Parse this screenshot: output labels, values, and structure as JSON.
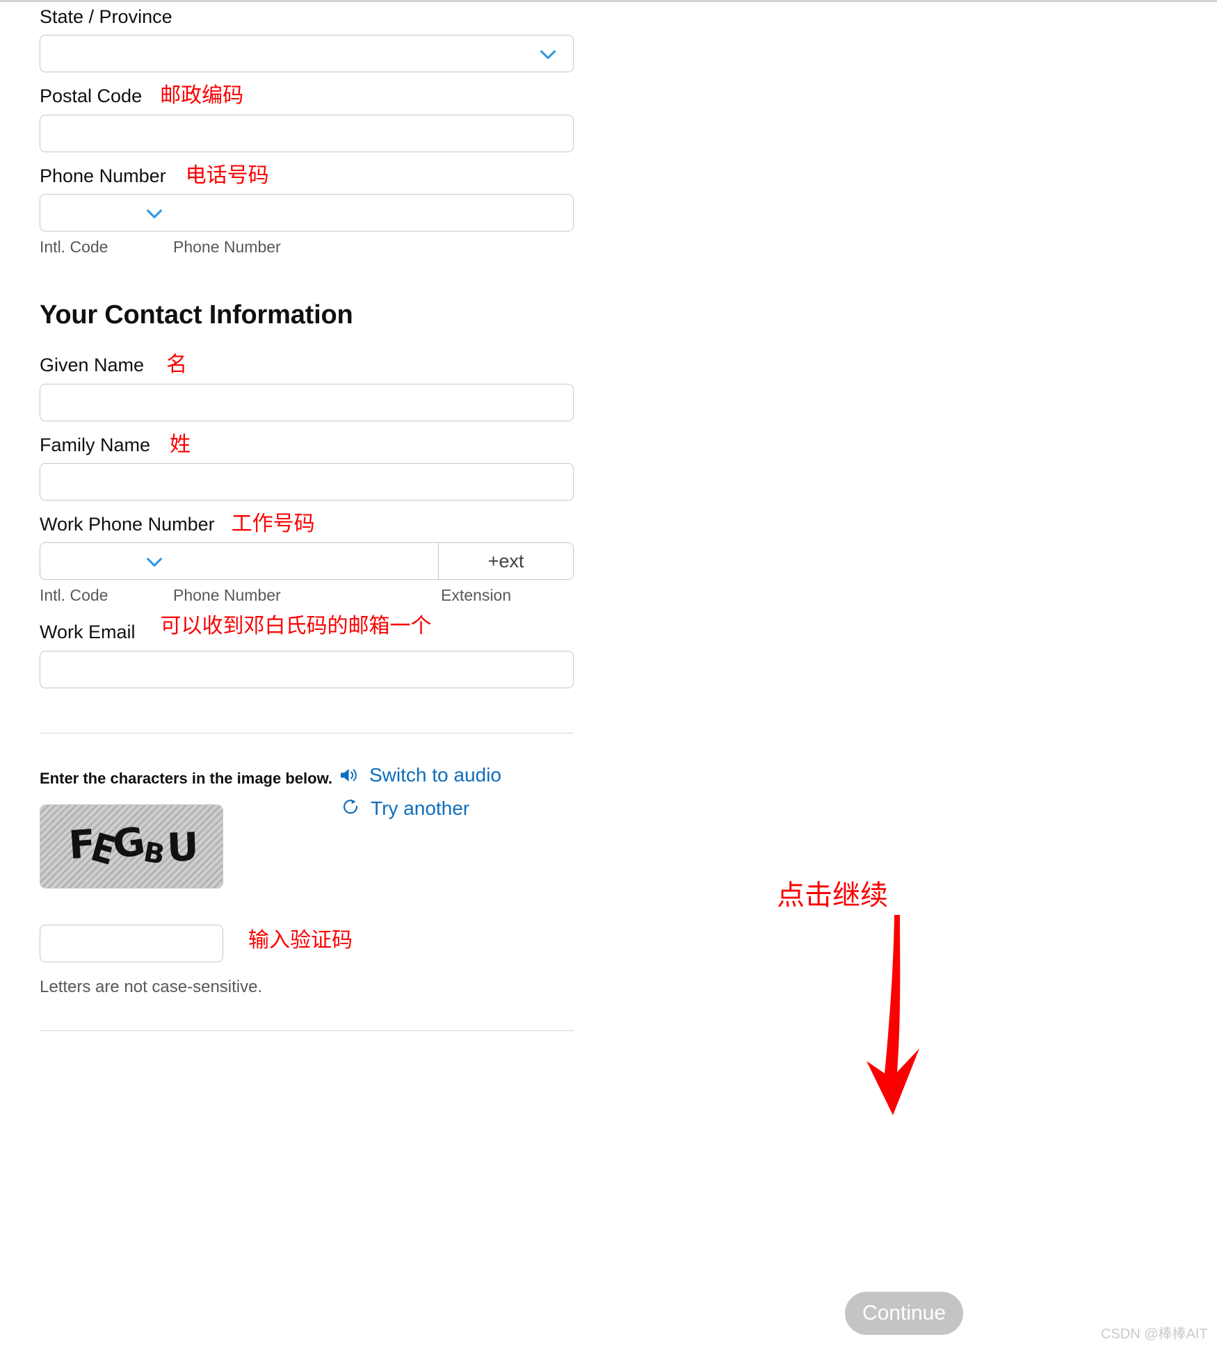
{
  "form": {
    "state_province": {
      "label": "State / Province",
      "value": "",
      "icon": "chevron-down-icon"
    },
    "postal_code": {
      "label": "Postal Code",
      "annotation": "邮政编码",
      "value": ""
    },
    "phone_number": {
      "label": "Phone Number",
      "annotation": "电话号码",
      "value": "",
      "sub_labels": {
        "intl_code": "Intl. Code",
        "phone_number": "Phone Number"
      }
    }
  },
  "contact_section": {
    "title": "Your Contact Information",
    "given_name": {
      "label": "Given Name",
      "annotation": "名",
      "value": ""
    },
    "family_name": {
      "label": "Family Name",
      "annotation": "姓",
      "value": ""
    },
    "work_phone": {
      "label": "Work Phone Number",
      "annotation": "工作号码",
      "value": "",
      "ext_placeholder": "+ext",
      "sub_labels": {
        "intl_code": "Intl. Code",
        "phone_number": "Phone Number",
        "extension": "Extension"
      }
    },
    "work_email": {
      "label": "Work Email",
      "annotation": "可以收到邓白氏码的邮箱一个",
      "value": ""
    }
  },
  "captcha": {
    "instruction": "Enter the characters in the image below.",
    "switch_audio_label": "Switch to audio",
    "try_another_label": "Try another",
    "image_characters": "FEGBU",
    "input_value": "",
    "input_annotation": "输入验证码",
    "case_note": "Letters are not case-sensitive."
  },
  "footer": {
    "continue_label": "Continue",
    "continue_annotation": "点击继续",
    "watermark": "CSDN @棒棒AIT"
  },
  "colors": {
    "annotation_red": "#fa0000",
    "link_blue": "#0d6dbd",
    "chevron_blue": "#3399e6",
    "button_gray": "#c4c4c4",
    "border_gray": "#c7c7cd"
  }
}
